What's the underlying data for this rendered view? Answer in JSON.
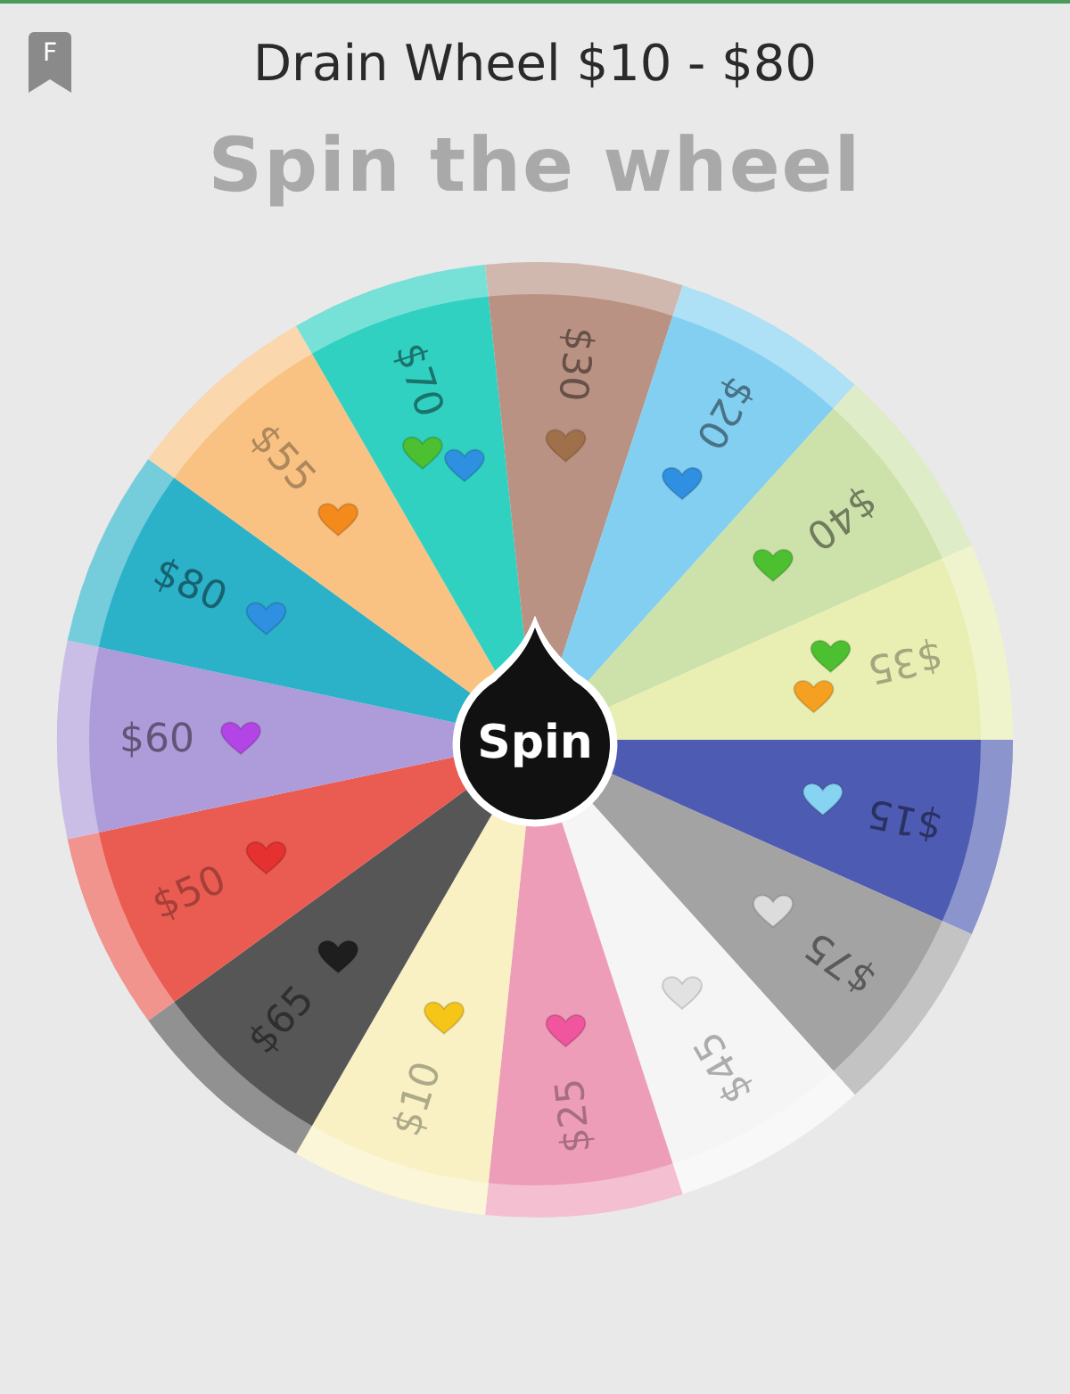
{
  "header": {
    "badge": "F",
    "title": "Drain Wheel $10 - $80"
  },
  "heading": "Spin the wheel",
  "wheel": {
    "spin_button": "Spin",
    "segments": [
      {
        "label": "$15",
        "color": "#4d5bb3",
        "hearts": [
          {
            "color": "#86d4f2"
          }
        ]
      },
      {
        "label": "$75",
        "color": "#a3a3a3",
        "hearts": [
          {
            "color": "#dcdcdc"
          }
        ]
      },
      {
        "label": "$45",
        "color": "#f5f5f5",
        "hearts": [
          {
            "color": "#e2e2e2"
          }
        ]
      },
      {
        "label": "$25",
        "color": "#ee9db8",
        "hearts": [
          {
            "color": "#f0559e"
          }
        ]
      },
      {
        "label": "$10",
        "color": "#f9f1c4",
        "hearts": [
          {
            "color": "#f5c518"
          }
        ]
      },
      {
        "label": "$65",
        "color": "#565656",
        "hearts": [
          {
            "color": "#1e1e1e"
          }
        ]
      },
      {
        "label": "$50",
        "color": "#ea5b52",
        "hearts": [
          {
            "color": "#e5312f"
          }
        ]
      },
      {
        "label": "$60",
        "color": "#ae9bd9",
        "hearts": [
          {
            "color": "#b345e6"
          }
        ]
      },
      {
        "label": "$80",
        "color": "#2bb2c9",
        "hearts": [
          {
            "color": "#2f8fe0"
          }
        ]
      },
      {
        "label": "$55",
        "color": "#f9c283",
        "hearts": [
          {
            "color": "#f58a1c"
          }
        ]
      },
      {
        "label": "$70",
        "color": "#31d1c2",
        "hearts": [
          {
            "color": "#4cc030"
          },
          {
            "color": "#2f8fe0"
          }
        ]
      },
      {
        "label": "$30",
        "color": "#b99283",
        "hearts": [
          {
            "color": "#a0704a"
          }
        ]
      },
      {
        "label": "$20",
        "color": "#83cff1",
        "hearts": [
          {
            "color": "#2f8fe0"
          }
        ]
      },
      {
        "label": "$40",
        "color": "#cde2aa",
        "hearts": [
          {
            "color": "#4cc030"
          }
        ]
      },
      {
        "label": "$35",
        "color": "#e9efb3",
        "hearts": [
          {
            "color": "#4cc030"
          },
          {
            "color": "#f5a020"
          }
        ]
      }
    ]
  }
}
